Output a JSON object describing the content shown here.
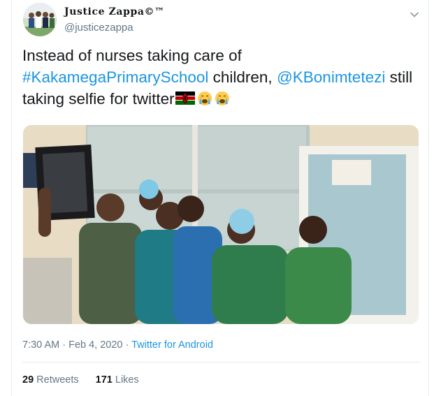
{
  "author": {
    "display_name": "Justice Zappa©™",
    "handle": "@justicezappa"
  },
  "tweet": {
    "text_part1": "Instead of nurses taking care of ",
    "hashtag": "#KakamegaPrimarySchool",
    "text_part2": " children, ",
    "mention": "@KBonimtetezi",
    "text_part3": " still taking selfie for twitter"
  },
  "meta": {
    "time": "7:30 AM",
    "sep1": " · ",
    "date": "Feb 4, 2020",
    "sep2": " · ",
    "source": "Twitter for Android"
  },
  "stats": {
    "retweets_count": "29",
    "retweets_label": " Retweets",
    "likes_count": "171",
    "likes_label": " Likes"
  },
  "icons": {
    "caret": "chevron-down-icon",
    "flag": "kenya-flag-icon",
    "emoji": "crying-face-icon"
  },
  "colors": {
    "link": "#1b95e0",
    "secondary": "#657786",
    "border": "#e6ecf0"
  }
}
